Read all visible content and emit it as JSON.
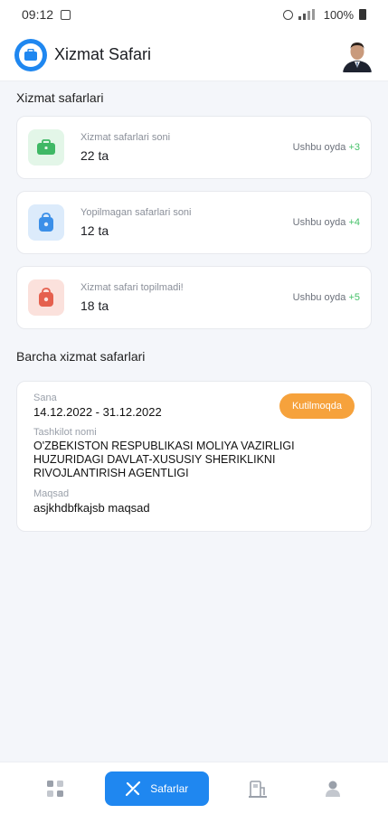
{
  "status_bar": {
    "time": "09:12",
    "battery": "100%"
  },
  "header": {
    "title": "Xizmat Safari"
  },
  "stats_section": {
    "title": "Xizmat safarlari"
  },
  "stats": [
    {
      "label": "Xizmat safarlari soni",
      "value": "22 ta",
      "month_label": "Ushbu oyda",
      "delta": "+3",
      "icon": "briefcase-icon",
      "icon_bg": "#e3f6e8",
      "icon_color": "#3fb865"
    },
    {
      "label": "Yopilmagan safarlari soni",
      "value": "12 ta",
      "month_label": "Ushbu oyda",
      "delta": "+4",
      "icon": "bag-icon",
      "icon_bg": "#dcebfb",
      "icon_color": "#3b8fe8"
    },
    {
      "label": "Xizmat safari topilmadi!",
      "value": "18 ta",
      "month_label": "Ushbu oyda",
      "delta": "+5",
      "icon": "bag-icon",
      "icon_bg": "#fbe1dc",
      "icon_color": "#e5604e"
    }
  ],
  "trips_section": {
    "title": "Barcha xizmat safarlari"
  },
  "trip": {
    "date_label": "Sana",
    "date": "14.12.2022 - 31.12.2022",
    "status": "Kutilmoqda",
    "org_label": "Tashkilot nomi",
    "org": "O'ZBEKISTON RESPUBLIKASI MOLIYA VAZIRLIGI HUZURIDAGI DAVLAT-XUSUSIY SHERIKLIKNI RIVOJLANTIRISH AGENTLIGI",
    "purpose_label": "Maqsad",
    "purpose": "asjkhdbfkajsb maqsad"
  },
  "nav": {
    "active_label": "Safarlar"
  },
  "colors": {
    "accent": "#1f87f0",
    "status_pending": "#f6a23c",
    "positive": "#46c16a"
  }
}
